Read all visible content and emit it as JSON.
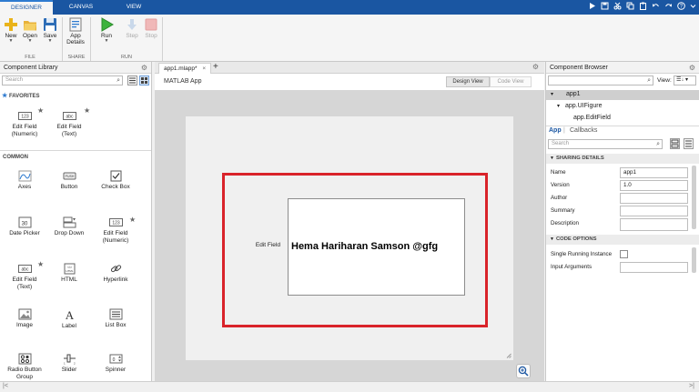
{
  "toolstrip_tabs": {
    "designer": "DESIGNER",
    "canvas": "CANVAS",
    "view": "VIEW"
  },
  "ribbon": {
    "new": "New",
    "open": "Open",
    "save": "Save",
    "app_details_line1": "App",
    "app_details_line2": "Details",
    "run": "Run",
    "step": "Step",
    "stop": "Stop",
    "section_file": "FILE",
    "section_share": "SHARE",
    "section_run": "RUN"
  },
  "component_library": {
    "title": "Component Library",
    "search_placeholder": "Search",
    "favorites_header": "FAVORITES",
    "common_header": "COMMON",
    "favorites": [
      {
        "line1": "Edit Field",
        "line2": "(Numeric)"
      },
      {
        "line1": "Edit Field",
        "line2": "(Text)"
      }
    ],
    "common": [
      {
        "line1": "Axes",
        "line2": ""
      },
      {
        "line1": "Button",
        "line2": ""
      },
      {
        "line1": "Check Box",
        "line2": ""
      },
      {
        "line1": "Date Picker",
        "line2": ""
      },
      {
        "line1": "Drop Down",
        "line2": ""
      },
      {
        "line1": "Edit Field",
        "line2": "(Numeric)"
      },
      {
        "line1": "Edit Field",
        "line2": "(Text)"
      },
      {
        "line1": "HTML",
        "line2": ""
      },
      {
        "line1": "Hyperlink",
        "line2": ""
      },
      {
        "line1": "Image",
        "line2": ""
      },
      {
        "line1": "Label",
        "line2": ""
      },
      {
        "line1": "List Box",
        "line2": ""
      },
      {
        "line1": "Radio Button",
        "line2": "Group"
      },
      {
        "line1": "Slider",
        "line2": ""
      },
      {
        "line1": "Spinner",
        "line2": ""
      }
    ]
  },
  "editor": {
    "file_tab": "app1.mlapp*",
    "app_title": "MATLAB App",
    "design_view": "Design View",
    "code_view": "Code View",
    "edit_field_label": "Edit Field",
    "edit_field_value": "Hema Hariharan Samson @gfg"
  },
  "component_browser": {
    "title": "Component Browser",
    "view_label": "View:",
    "tree": {
      "root": "app1",
      "figure": "app.UIFigure",
      "field": "app.EditField"
    },
    "tab_app": "App",
    "tab_callbacks": "Callbacks",
    "search_placeholder": "Search",
    "sharing_header": "SHARING DETAILS",
    "name_label": "Name",
    "name_value": "app1",
    "version_label": "Version",
    "version_value": "1.0",
    "author_label": "Author",
    "summary_label": "Summary",
    "description_label": "Description",
    "code_options_header": "CODE OPTIONS",
    "single_running_label": "Single Running Instance",
    "input_args_label": "Input Arguments"
  },
  "colors": {
    "accent": "#1a56a2",
    "highlight_border": "#d9232a",
    "selected_tree": "#cfcfcf"
  }
}
